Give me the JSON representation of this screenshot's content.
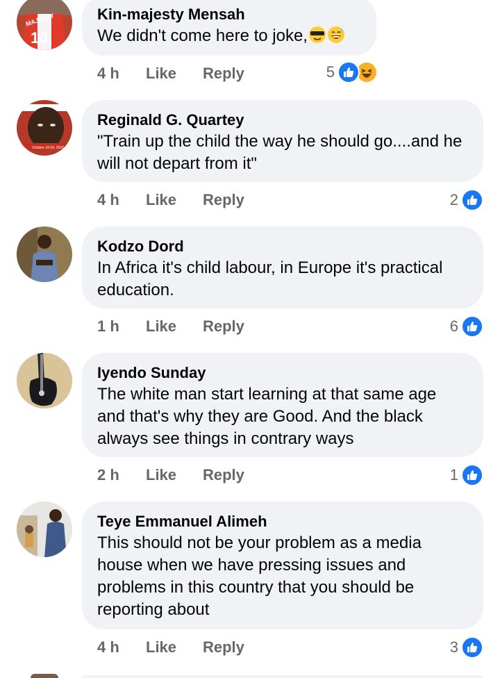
{
  "comments": [
    {
      "author": "Kin-majesty Mensah",
      "text": "We didn't come here to joke,",
      "emojis": [
        "sunglasses-face",
        "grinning-sweat-face"
      ],
      "time": "4 h",
      "like_label": "Like",
      "reply_label": "Reply",
      "reaction_count": "5",
      "reaction_icons": [
        "like-reaction",
        "haha-reaction"
      ],
      "avatar_text": "MAJESTY 10"
    },
    {
      "author": "Reginald G. Quartey",
      "text": "\"Train up the child the way he should go....and he will not depart from it\"",
      "time": "4 h",
      "like_label": "Like",
      "reply_label": "Reply",
      "reaction_count": "2",
      "reaction_icons": [
        "like-reaction"
      ]
    },
    {
      "author": "Kodzo Dord",
      "text": "In Africa it's child labour, in Europe it's practical education.",
      "time": "1 h",
      "like_label": "Like",
      "reply_label": "Reply",
      "reaction_count": "6",
      "reaction_icons": [
        "like-reaction"
      ]
    },
    {
      "author": "Iyendo Sunday",
      "text": "The white man start learning at that same age and that's why they are Good. And the black always see things in contrary ways",
      "time": "2 h",
      "like_label": "Like",
      "reply_label": "Reply",
      "reaction_count": "1",
      "reaction_icons": [
        "like-reaction"
      ]
    },
    {
      "author": "Teye Emmanuel Alimeh",
      "text": "This should not be your problem as a media house when we have pressing issues and problems in this country that you should be reporting about",
      "time": "4 h",
      "like_label": "Like",
      "reply_label": "Reply",
      "reaction_count": "3",
      "reaction_icons": [
        "like-reaction"
      ]
    }
  ],
  "colors": {
    "bubble_bg": "#f0f2f5",
    "action_text": "#65676b",
    "like_blue": "#1877f2",
    "haha_yellow": "#f7b125"
  }
}
